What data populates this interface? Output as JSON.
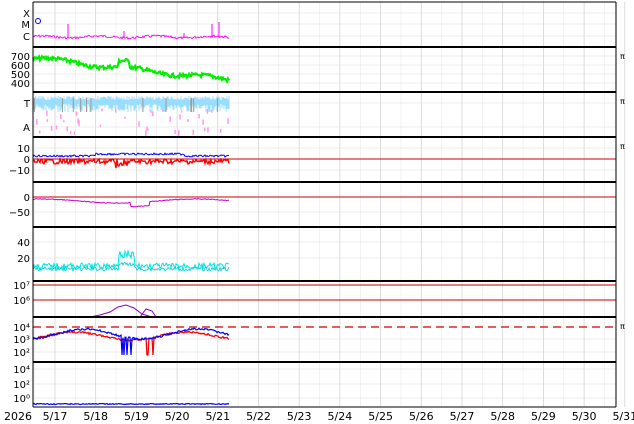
{
  "chart_data": {
    "type": "line",
    "x_start_label": "2026",
    "x_ticks": [
      "5/17",
      "5/18",
      "5/19",
      "5/20",
      "5/21",
      "5/22",
      "5/23",
      "5/24",
      "5/25",
      "5/26",
      "5/27",
      "5/28",
      "5/29",
      "5/30",
      "5/31"
    ],
    "data_end": "5/21 ~12:00",
    "panels": [
      {
        "id": "xray",
        "tick_labels": [
          "X",
          "M",
          "C"
        ],
        "right_label": "",
        "series": [
          {
            "color": "#ff00ff",
            "kind": "noisy-baseline"
          }
        ]
      },
      {
        "id": "speed",
        "tick_labels": [
          "700",
          "600",
          "500",
          "400"
        ],
        "right_label": "π",
        "series": [
          {
            "color": "#00ff00",
            "kind": "decreasing",
            "start": 650,
            "end": 420
          }
        ]
      },
      {
        "id": "temp",
        "tick_labels": [
          "T",
          "A"
        ],
        "right_label": "π",
        "series": [
          {
            "color": "#88ddff",
            "kind": "band"
          },
          {
            "color": "#ff88ff",
            "kind": "sparse"
          }
        ]
      },
      {
        "id": "bfield",
        "tick_labels": [
          "10",
          "0",
          "−10"
        ],
        "right_label": "π",
        "series": [
          {
            "color": "#0000ff",
            "kind": "positive"
          },
          {
            "color": "#ff0000",
            "kind": "negative"
          }
        ],
        "reference_line": 0
      },
      {
        "id": "dst",
        "tick_labels": [
          "0",
          "−50"
        ],
        "right_label": "",
        "series": [
          {
            "color": "#cc00cc",
            "kind": "wavy"
          }
        ],
        "reference_line": 0
      },
      {
        "id": "kp",
        "tick_labels": [
          "40",
          "20"
        ],
        "right_label": "",
        "series": [
          {
            "color": "#00e5e5",
            "kind": "noisy-low"
          }
        ]
      },
      {
        "id": "proton",
        "tick_labels": [
          "10⁷",
          "10⁶"
        ],
        "right_label": "",
        "series": [
          {
            "color": "#8800cc",
            "kind": "bumps"
          }
        ],
        "reference_lines": [
          "10⁷",
          "10⁶"
        ]
      },
      {
        "id": "electron",
        "tick_labels": [
          "10⁴",
          "10³",
          "10²"
        ],
        "right_label": "π",
        "series": [
          {
            "color": "#0000ff",
            "kind": "log-wavy"
          },
          {
            "color": "#ff0000",
            "kind": "log-wavy"
          }
        ],
        "reference_line_dashed": "10⁴"
      },
      {
        "id": "neutron",
        "tick_labels": [
          "10⁴",
          "10²",
          "10⁰"
        ],
        "right_label": "",
        "series": [
          {
            "color": "#0000ff",
            "kind": "flat-low"
          }
        ]
      }
    ]
  }
}
